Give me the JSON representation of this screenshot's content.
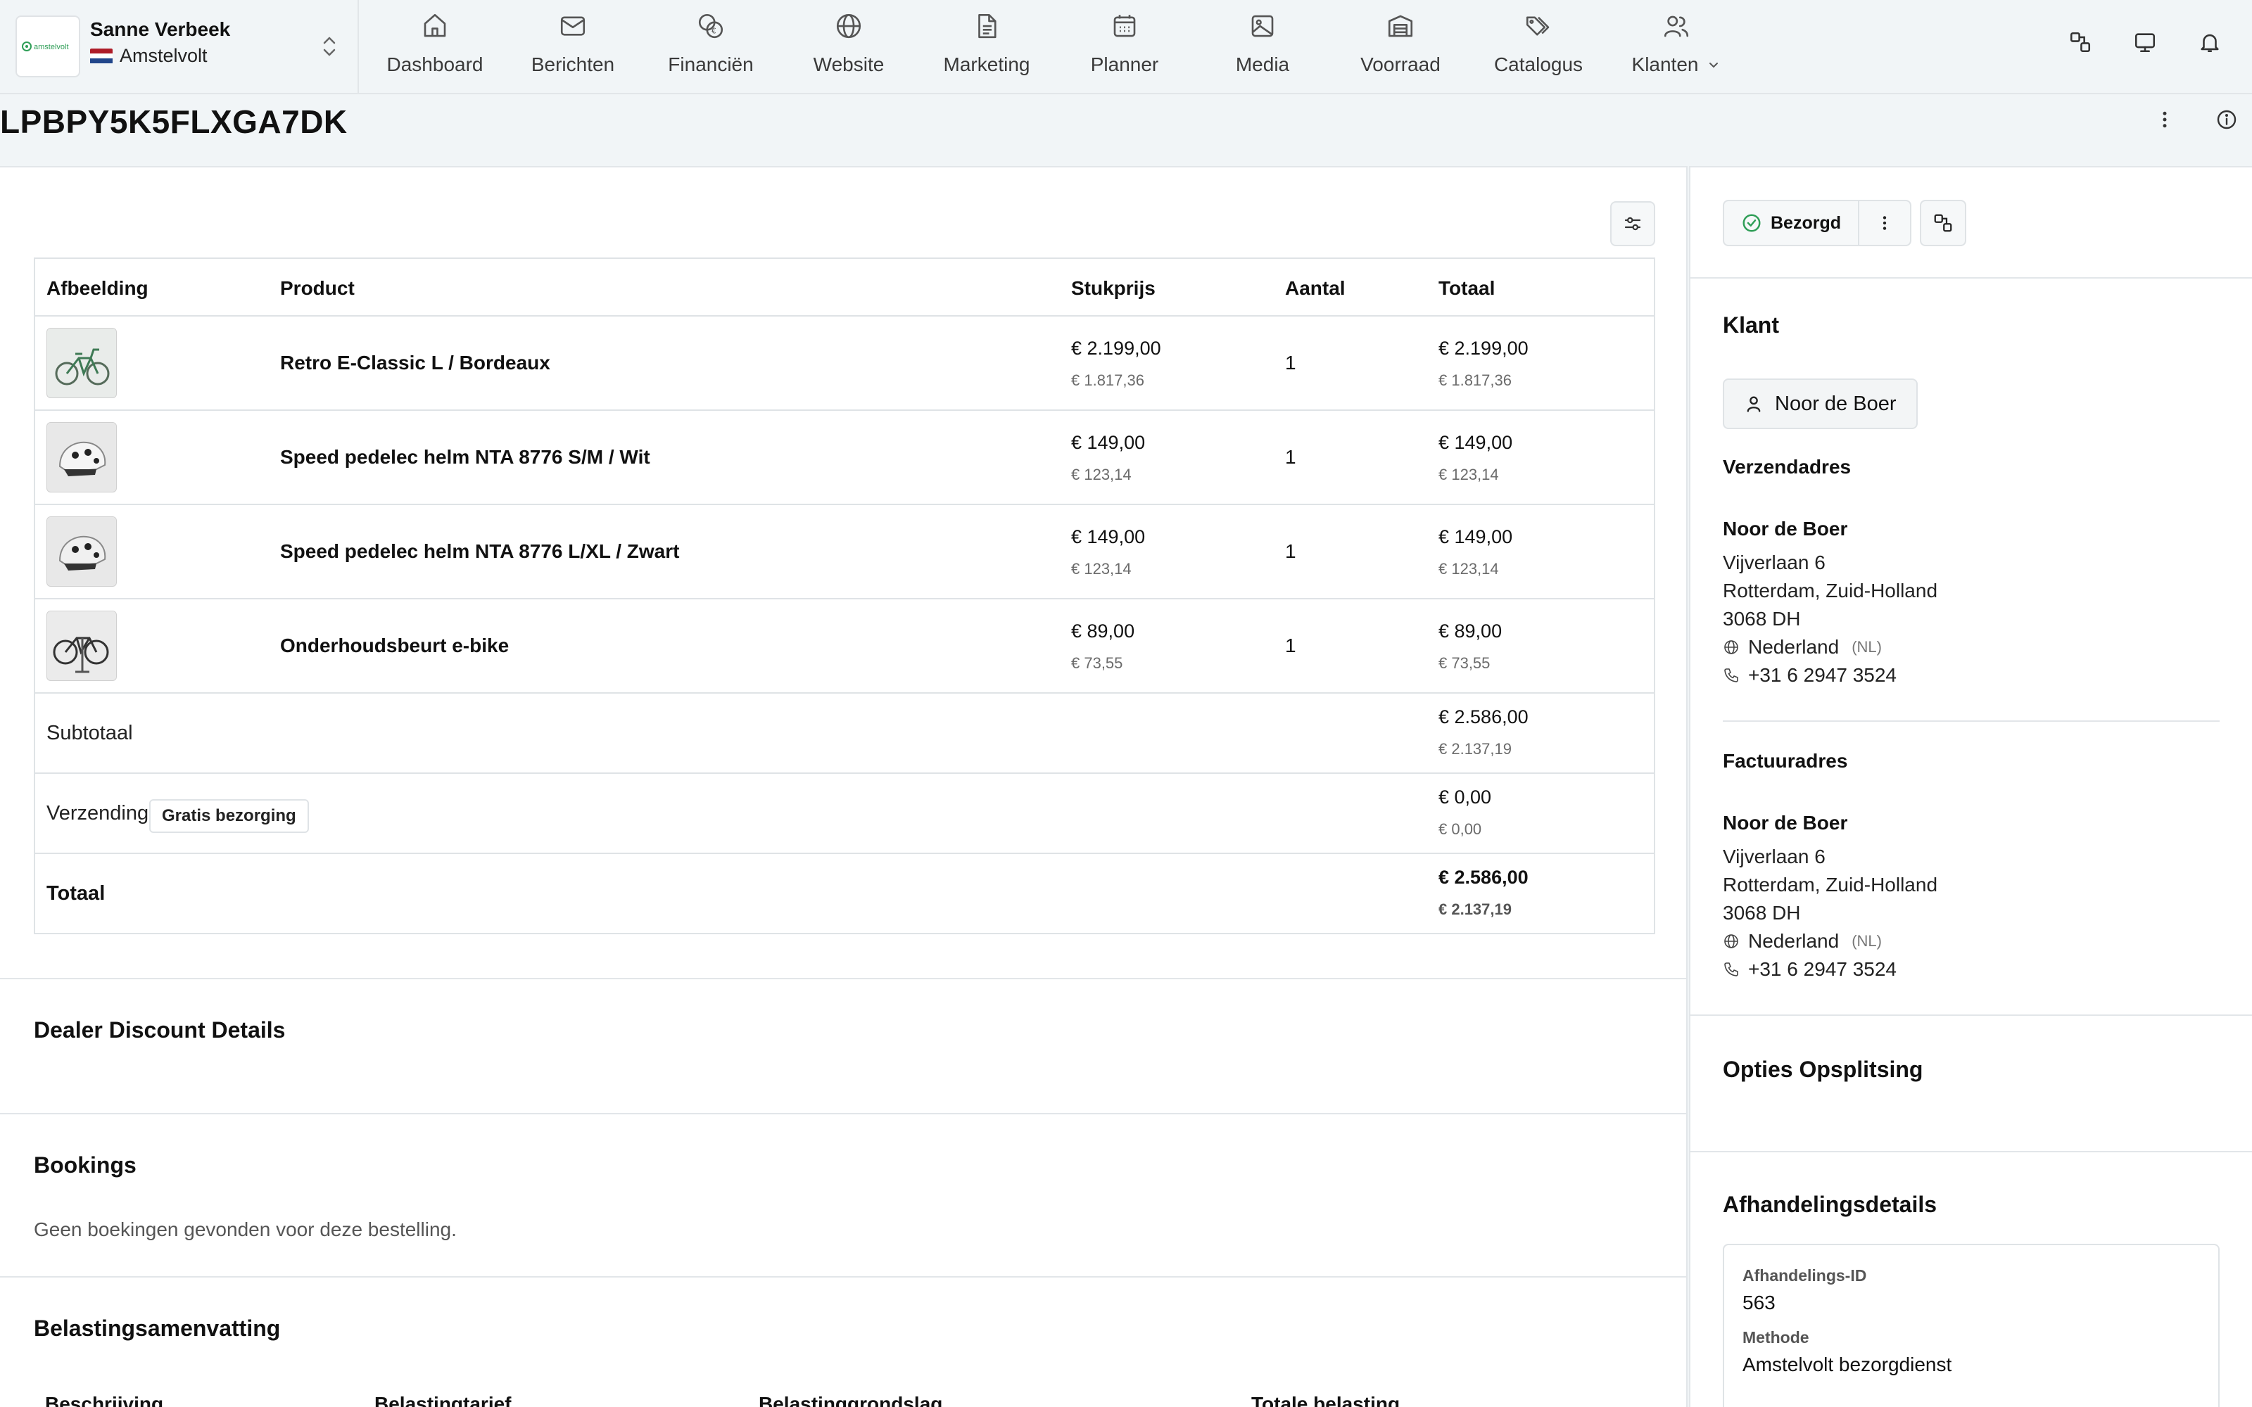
{
  "store": {
    "user_name": "Sanne Verbeek",
    "store_name": "Amstelvolt",
    "logo_text": "amstelvolt"
  },
  "nav": [
    {
      "label": "Dashboard",
      "icon": "home-icon"
    },
    {
      "label": "Berichten",
      "icon": "mail-icon"
    },
    {
      "label": "Financiën",
      "icon": "coins-icon"
    },
    {
      "label": "Website",
      "icon": "globe-icon"
    },
    {
      "label": "Marketing",
      "icon": "document-icon"
    },
    {
      "label": "Planner",
      "icon": "calendar-icon"
    },
    {
      "label": "Media",
      "icon": "image-icon"
    },
    {
      "label": "Voorraad",
      "icon": "warehouse-icon"
    },
    {
      "label": "Catalogus",
      "icon": "tags-icon"
    },
    {
      "label": "Klanten",
      "icon": "users-icon"
    }
  ],
  "page": {
    "title": "LPBPY5K5FLXGA7DK"
  },
  "table": {
    "headers": [
      "Afbeelding",
      "Product",
      "Stukprijs",
      "Aantal",
      "Totaal"
    ],
    "rows": [
      {
        "product": "Retro E-Classic L / Bordeaux",
        "unit_price": "€ 2.199,00",
        "unit_price_ex": "€ 1.817,36",
        "qty": "1",
        "total": "€ 2.199,00",
        "total_ex": "€ 1.817,36",
        "thumb": "bike"
      },
      {
        "product": "Speed pedelec helm NTA 8776 S/M / Wit",
        "unit_price": "€ 149,00",
        "unit_price_ex": "€ 123,14",
        "qty": "1",
        "total": "€ 149,00",
        "total_ex": "€ 123,14",
        "thumb": "helmet"
      },
      {
        "product": "Speed pedelec helm NTA 8776 L/XL / Zwart",
        "unit_price": "€ 149,00",
        "unit_price_ex": "€ 123,14",
        "qty": "1",
        "total": "€ 149,00",
        "total_ex": "€ 123,14",
        "thumb": "helmet"
      },
      {
        "product": "Onderhoudsbeurt e-bike",
        "unit_price": "€ 89,00",
        "unit_price_ex": "€ 73,55",
        "qty": "1",
        "total": "€ 89,00",
        "total_ex": "€ 73,55",
        "thumb": "repair"
      }
    ],
    "subtotal": {
      "label": "Subtotaal",
      "value": "€ 2.586,00",
      "value_ex": "€ 2.137,19"
    },
    "shipping": {
      "label": "Verzending",
      "badge": "Gratis bezorging",
      "value": "€ 0,00",
      "value_ex": "€ 0,00"
    },
    "total": {
      "label": "Totaal",
      "value": "€ 2.586,00",
      "value_ex": "€ 2.137,19"
    }
  },
  "sections": {
    "dealer_discount": "Dealer Discount Details",
    "bookings": "Bookings",
    "bookings_empty": "Geen boekingen gevonden voor deze bestelling.",
    "tax_summary": "Belastingsamenvatting",
    "tax_columns": [
      "Beschrijving",
      "Belastingtarief",
      "Belastinggrondslag",
      "Totale belasting"
    ]
  },
  "sidebar": {
    "status": "Bezorgd",
    "customer_title": "Klant",
    "customer_name": "Noor de Boer",
    "shipping_title": "Verzendadres",
    "shipping": {
      "name": "Noor de Boer",
      "street": "Vijverlaan 6",
      "city": "Rotterdam, Zuid-Holland",
      "zip": "3068 DH",
      "country": "Nederland",
      "country_code": "(NL)",
      "phone": "+31 6 2947 3524"
    },
    "billing_title": "Factuuradres",
    "billing": {
      "name": "Noor de Boer",
      "street": "Vijverlaan 6",
      "city": "Rotterdam, Zuid-Holland",
      "zip": "3068 DH",
      "country": "Nederland",
      "country_code": "(NL)",
      "phone": "+31 6 2947 3524"
    },
    "options_title": "Opties Opsplitsing",
    "fulfillment_title": "Afhandelingsdetails",
    "fulfillment": {
      "id_label": "Afhandelings-ID",
      "id_value": "563",
      "method_label": "Methode",
      "method_value": "Amstelvolt bezorgdienst"
    }
  },
  "colors": {
    "accent_green": "#2f9e57",
    "flag_red": "#ae1c28",
    "flag_blue": "#21468b"
  }
}
